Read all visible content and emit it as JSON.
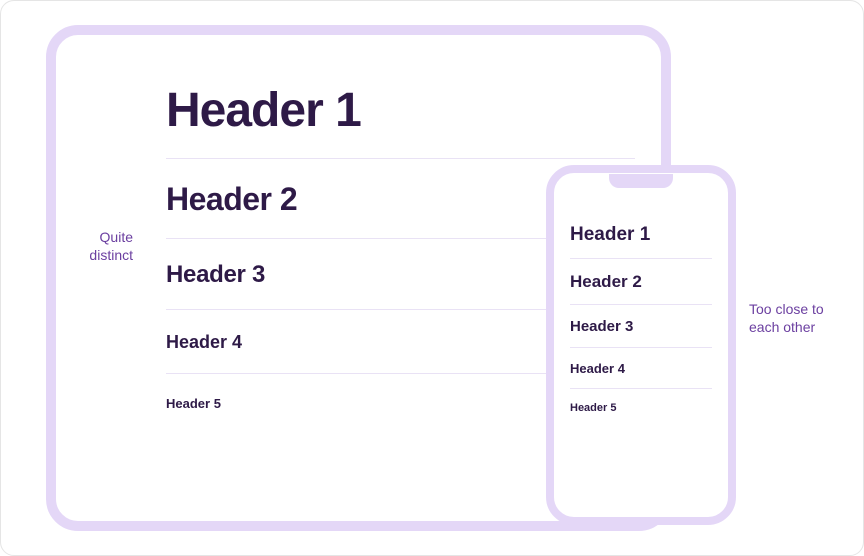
{
  "tablet": {
    "headers": [
      "Header 1",
      "Header 2",
      "Header 3",
      "Header 4",
      "Header 5"
    ]
  },
  "phone": {
    "headers": [
      "Header 1",
      "Header 2",
      "Header 3",
      "Header 4",
      "Header 5"
    ]
  },
  "annotations": {
    "left": "Quite distinct",
    "right": "Too close to each other"
  },
  "colors": {
    "device_border": "#E4D7F7",
    "text": "#2E1A47",
    "annotation": "#6B3FA0",
    "divider": "#E9E2F5"
  }
}
